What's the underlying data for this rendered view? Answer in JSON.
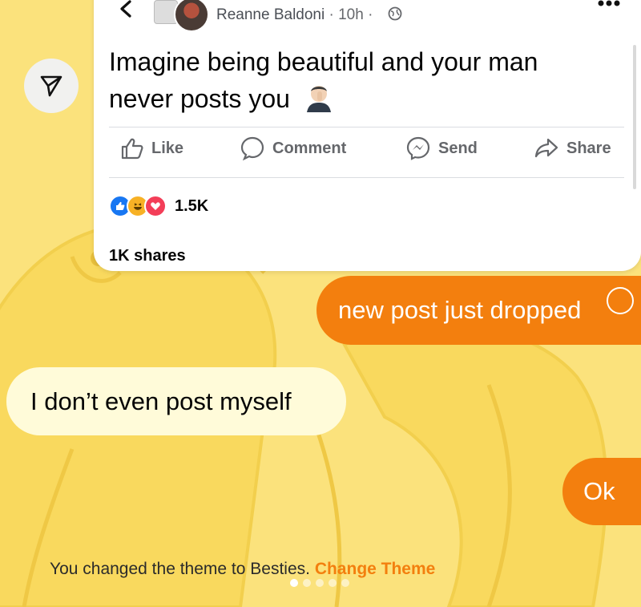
{
  "post": {
    "author": "Reanne Baldoni",
    "meta": "· 10h ·",
    "text": "Imagine being beautiful and your man never posts you",
    "actions": {
      "like": "Like",
      "comment": "Comment",
      "send": "Send",
      "share": "Share"
    },
    "reaction_count": "1.5K",
    "shares": "1K shares"
  },
  "messages": [
    {
      "text": "new post just dropped",
      "direction": "outgoing"
    },
    {
      "text": "I don’t even post myself",
      "direction": "incoming"
    },
    {
      "text": "Ok",
      "direction": "outgoing"
    }
  ],
  "theme": {
    "note": "You changed the theme to Besties.",
    "link": "Change Theme"
  },
  "colors": {
    "accent": "#f37f0e",
    "background": "#fbe27c",
    "incoming_bubble": "#fffbd9",
    "like_blue": "#1877f2",
    "love_red": "#f33e58"
  },
  "icons": [
    "back-chevron-icon",
    "globe-icon",
    "more-icon",
    "share-arrow-icon",
    "like-icon",
    "comment-icon",
    "messenger-icon",
    "share-icon"
  ]
}
